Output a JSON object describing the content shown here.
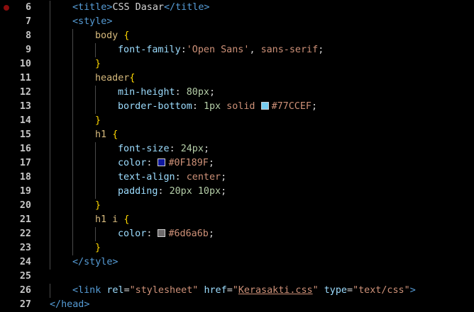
{
  "colors": {
    "background": "#000000",
    "line_number": "#c6c6c6",
    "breakpoint": "#8b0d0d",
    "tag": "#569cd6",
    "text": "#d4d4d4",
    "selector": "#d7ba7d",
    "brace": "#ffd700",
    "property": "#9cdcfe",
    "value": "#ce9178",
    "number": "#b5cea8",
    "string": "#ce9178"
  },
  "editor": {
    "lines": [
      {
        "number": "6",
        "breakpoint": true,
        "indent": 1,
        "tokens": [
          {
            "text": "<title>",
            "kind": "tag"
          },
          {
            "text": "CSS Dasar",
            "kind": "text"
          },
          {
            "text": "</title>",
            "kind": "tag"
          }
        ]
      },
      {
        "number": "7",
        "indent": 1,
        "tokens": [
          {
            "text": "<style>",
            "kind": "tag"
          }
        ]
      },
      {
        "number": "8",
        "indent": 2,
        "tokens": [
          {
            "text": "body",
            "kind": "selector"
          },
          {
            "text": " ",
            "kind": "text"
          },
          {
            "text": "{",
            "kind": "brace"
          }
        ]
      },
      {
        "number": "9",
        "indent": 3,
        "tokens": [
          {
            "text": "font-family",
            "kind": "property"
          },
          {
            "text": ":",
            "kind": "text"
          },
          {
            "text": "'Open Sans'",
            "kind": "string"
          },
          {
            "text": ", ",
            "kind": "text"
          },
          {
            "text": "sans-serif",
            "kind": "value"
          },
          {
            "text": ";",
            "kind": "text"
          }
        ]
      },
      {
        "number": "10",
        "indent": 2,
        "tokens": [
          {
            "text": "}",
            "kind": "brace"
          }
        ]
      },
      {
        "number": "11",
        "indent": 2,
        "tokens": [
          {
            "text": "header",
            "kind": "selector"
          },
          {
            "text": "{",
            "kind": "brace"
          }
        ]
      },
      {
        "number": "12",
        "indent": 3,
        "tokens": [
          {
            "text": "min-height",
            "kind": "property"
          },
          {
            "text": ": ",
            "kind": "text"
          },
          {
            "text": "80px",
            "kind": "number"
          },
          {
            "text": ";",
            "kind": "text"
          }
        ]
      },
      {
        "number": "13",
        "indent": 3,
        "tokens": [
          {
            "text": "border-bottom",
            "kind": "property"
          },
          {
            "text": ": ",
            "kind": "text"
          },
          {
            "text": "1px",
            "kind": "number"
          },
          {
            "text": " solid ",
            "kind": "value"
          },
          {
            "swatch": "#77CCEF"
          },
          {
            "text": "#77CCEF",
            "kind": "value"
          },
          {
            "text": ";",
            "kind": "text"
          }
        ]
      },
      {
        "number": "14",
        "indent": 2,
        "tokens": [
          {
            "text": "}",
            "kind": "brace"
          }
        ]
      },
      {
        "number": "15",
        "indent": 2,
        "tokens": [
          {
            "text": "h1",
            "kind": "selector"
          },
          {
            "text": " ",
            "kind": "text"
          },
          {
            "text": "{",
            "kind": "brace"
          }
        ]
      },
      {
        "number": "16",
        "indent": 3,
        "tokens": [
          {
            "text": "font-size",
            "kind": "property"
          },
          {
            "text": ": ",
            "kind": "text"
          },
          {
            "text": "24px",
            "kind": "number"
          },
          {
            "text": ";",
            "kind": "text"
          }
        ]
      },
      {
        "number": "17",
        "indent": 3,
        "tokens": [
          {
            "text": "color",
            "kind": "property"
          },
          {
            "text": ": ",
            "kind": "text"
          },
          {
            "swatch": "#0F189F"
          },
          {
            "text": "#0F189F",
            "kind": "value"
          },
          {
            "text": ";",
            "kind": "text"
          }
        ]
      },
      {
        "number": "18",
        "indent": 3,
        "tokens": [
          {
            "text": "text-align",
            "kind": "property"
          },
          {
            "text": ": ",
            "kind": "text"
          },
          {
            "text": "center",
            "kind": "value"
          },
          {
            "text": ";",
            "kind": "text"
          }
        ]
      },
      {
        "number": "19",
        "indent": 3,
        "tokens": [
          {
            "text": "padding",
            "kind": "property"
          },
          {
            "text": ": ",
            "kind": "text"
          },
          {
            "text": "20px",
            "kind": "number"
          },
          {
            "text": " ",
            "kind": "text"
          },
          {
            "text": "10px",
            "kind": "number"
          },
          {
            "text": ";",
            "kind": "text"
          }
        ]
      },
      {
        "number": "20",
        "indent": 2,
        "tokens": [
          {
            "text": "}",
            "kind": "brace"
          }
        ]
      },
      {
        "number": "21",
        "indent": 2,
        "tokens": [
          {
            "text": "h1 i",
            "kind": "selector"
          },
          {
            "text": " ",
            "kind": "text"
          },
          {
            "text": "{",
            "kind": "brace"
          }
        ]
      },
      {
        "number": "22",
        "indent": 3,
        "tokens": [
          {
            "text": "color",
            "kind": "property"
          },
          {
            "text": ": ",
            "kind": "text"
          },
          {
            "swatch": "#6d6a6b"
          },
          {
            "text": "#6d6a6b",
            "kind": "value"
          },
          {
            "text": ";",
            "kind": "text"
          }
        ]
      },
      {
        "number": "23",
        "indent": 2,
        "tokens": [
          {
            "text": "}",
            "kind": "brace"
          }
        ]
      },
      {
        "number": "24",
        "indent": 1,
        "tokens": [
          {
            "text": "</style>",
            "kind": "tag"
          }
        ]
      },
      {
        "number": "25",
        "indent": 0,
        "tokens": []
      },
      {
        "number": "26",
        "indent": 1,
        "tokens": [
          {
            "text": "<link",
            "kind": "tag"
          },
          {
            "text": " ",
            "kind": "text"
          },
          {
            "text": "rel",
            "kind": "property"
          },
          {
            "text": "=",
            "kind": "text"
          },
          {
            "text": "\"stylesheet\"",
            "kind": "string"
          },
          {
            "text": " ",
            "kind": "text"
          },
          {
            "text": "href",
            "kind": "property"
          },
          {
            "text": "=",
            "kind": "text"
          },
          {
            "text": "\"",
            "kind": "string"
          },
          {
            "text": "Kerasakti.css",
            "kind": "link"
          },
          {
            "text": "\"",
            "kind": "string"
          },
          {
            "text": " ",
            "kind": "text"
          },
          {
            "text": "type",
            "kind": "property"
          },
          {
            "text": "=",
            "kind": "text"
          },
          {
            "text": "\"text/css\"",
            "kind": "string"
          },
          {
            "text": ">",
            "kind": "tag"
          }
        ]
      },
      {
        "number": "27",
        "indent": 0,
        "tokens": [
          {
            "text": "</head>",
            "kind": "tag"
          }
        ]
      }
    ]
  }
}
